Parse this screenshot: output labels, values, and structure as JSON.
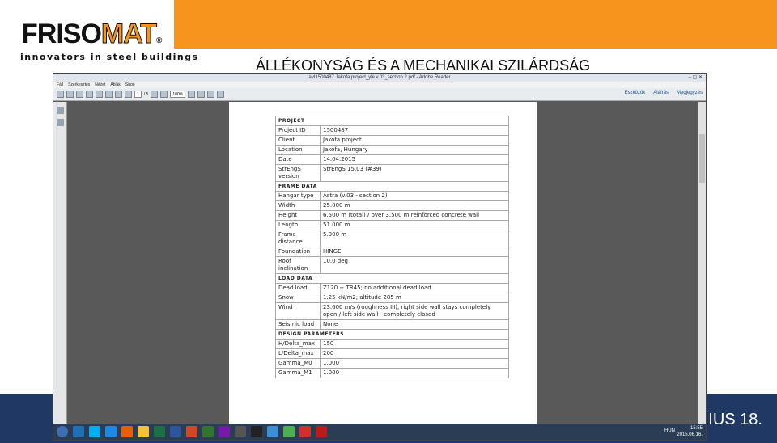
{
  "brand": {
    "logo_part1": "FRISO",
    "logo_part2": "MAT",
    "logo_mark": "®",
    "tagline": "innovators in steel buildings"
  },
  "slide_title": "ÁLLÉKONYSÁG ÉS A MECHANIKAI SZILÁRDSÁG",
  "footer_date": "NIUS 18.",
  "window": {
    "title": "avt1500487 Jakofa project_yle v.03_section 2.pdf - Adobe Reader",
    "controls": "–  ▢  ✕",
    "menu": [
      "Fájl",
      "Szerkesztés",
      "Nézet",
      "Ablak",
      "Súgó"
    ],
    "page_num": "1",
    "page_total": "/ 5",
    "zoom": "100%",
    "right_tools": [
      "Eszközök",
      "Aláírás",
      "Megjegyzés"
    ]
  },
  "report": {
    "sections": [
      {
        "title": "Project",
        "rows": [
          [
            "Project ID",
            "1500487"
          ],
          [
            "Client",
            "Jakofa project"
          ],
          [
            "Location",
            "Jakofa, Hungary"
          ],
          [
            "Date",
            "14.04.2015"
          ],
          [
            "StrEngS version",
            "StrEngS 15.03 (#39)"
          ]
        ]
      },
      {
        "title": "Frame data",
        "rows": [
          [
            "Hangar type",
            "Astra (v.03 - section 2)"
          ],
          [
            "Width",
            "25.000 m"
          ],
          [
            "Height",
            "6.500 m (total) / over 3.500 m reinforced concrete wall"
          ],
          [
            "Length",
            "51.000 m"
          ],
          [
            "Frame distance",
            "5.000 m"
          ],
          [
            "Foundation",
            "HINGE"
          ],
          [
            "Roof inclination",
            "10.0 deg"
          ]
        ]
      },
      {
        "title": "Load data",
        "rows": [
          [
            "Dead load",
            "Z120 + TR45; no additional dead load"
          ],
          [
            "Snow",
            "1.25 kN/m2; altitude 285 m"
          ],
          [
            "Wind",
            "23.600 m/s (roughness III), right side wall stays completely open / left side wall - completely closed"
          ],
          [
            "Seismic load",
            "None"
          ]
        ]
      },
      {
        "title": "Design parameters",
        "rows": [
          [
            "H/Delta_max",
            "150"
          ],
          [
            "L/Delta_max",
            "200"
          ],
          [
            "Gamma_M0",
            "1.000"
          ],
          [
            "Gamma_M1",
            "1.000"
          ]
        ]
      }
    ]
  },
  "taskbar": {
    "lang": "HUN",
    "time": "15:55",
    "date": "2015.06.16.",
    "apps": [
      "outlook-icon",
      "skype-icon",
      "ie-icon",
      "firefox-icon",
      "explorer-icon",
      "excel-icon",
      "word-icon",
      "powerpoint-icon",
      "project-icon",
      "onenote-icon",
      "app-icon",
      "terminal-icon",
      "paint-icon",
      "chrome-icon",
      "acrobat-icon",
      "reader-icon"
    ],
    "app_colors": [
      "#1f6fb5",
      "#00aff0",
      "#1e88e5",
      "#e66000",
      "#f3c13a",
      "#1d7044",
      "#2b579a",
      "#d24726",
      "#31752f",
      "#7719aa",
      "#555555",
      "#222222",
      "#3a8fd6",
      "#4caf50",
      "#d32f2f",
      "#b71c1c"
    ]
  }
}
